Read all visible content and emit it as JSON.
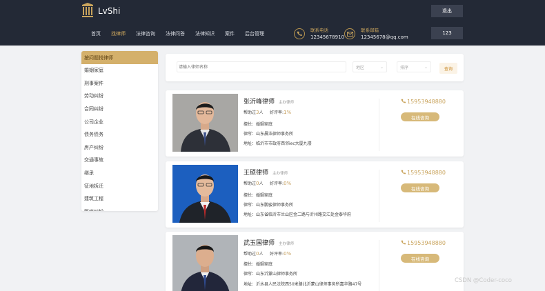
{
  "header": {
    "brand": "LvShi",
    "nav": [
      "首页",
      "找律师",
      "法律咨询",
      "法律问答",
      "法律知识",
      "案件",
      "后台管理"
    ],
    "active_nav": 1,
    "phone_label": "联系电话",
    "phone_value": "12345678910",
    "email_label": "联系邮箱",
    "email_value": "12345678@qq.com",
    "logout_label": "退出",
    "user_label": "123"
  },
  "sidebar": {
    "title": "按问题找律师",
    "items": [
      "婚姻家庭",
      "刑事案件",
      "劳动纠纷",
      "合同纠纷",
      "公司企业",
      "债务债务",
      "房产纠纷",
      "交通事故",
      "继承",
      "征地拆迁",
      "建筑工程",
      "医疗纠纷"
    ]
  },
  "search": {
    "placeholder": "请输入律师名称",
    "select1": "地区",
    "select2": "排序",
    "button": "查询"
  },
  "lawyers": [
    {
      "name": "张沂峰律师",
      "role": "主办律师",
      "help_label": "帮助过",
      "help_count": "3",
      "help_unit": "人",
      "rate_label": "好评率:",
      "rate": "1%",
      "specialty": "擅长：婚姻家庭",
      "firm": "律所：山东晨浩律师事务所",
      "address": "地址：临沂市市政府西邻iec大厦九楼",
      "phone": "15953948880",
      "consult": "在线咨询"
    },
    {
      "name": "王硕律师",
      "role": "主办律师",
      "help_label": "帮助过",
      "help_count": "0",
      "help_unit": "人",
      "rate_label": "好评率:",
      "rate": "0%",
      "specialty": "擅长：婚姻家庭",
      "firm": "律所：山东鹏骏律师事务所",
      "address": "地址：山东省临沂市兰山区金二路与沂州路交汇处金泰华府",
      "phone": "15953948880",
      "consult": "在线咨询"
    },
    {
      "name": "武玉国律师",
      "role": "主办律师",
      "help_label": "帮助过",
      "help_count": "0",
      "help_unit": "人",
      "rate_label": "好评率:",
      "rate": "0%",
      "specialty": "擅长：婚姻家庭",
      "firm": "律所：山东沂蒙山律师事务所",
      "address": "地址：沂水县人民法院西50米路北沂蒙山律师事务所嘉华路47号",
      "phone": "15953948880",
      "consult": "在线咨询"
    }
  ],
  "watermark": "CSDN @Coder-coco",
  "colors": {
    "header_bg": "#232936",
    "accent_gold": "#d4b06b",
    "page_bg": "#f1f2f4"
  },
  "icons": [
    "logo-icon",
    "phone-icon",
    "mail-icon"
  ]
}
